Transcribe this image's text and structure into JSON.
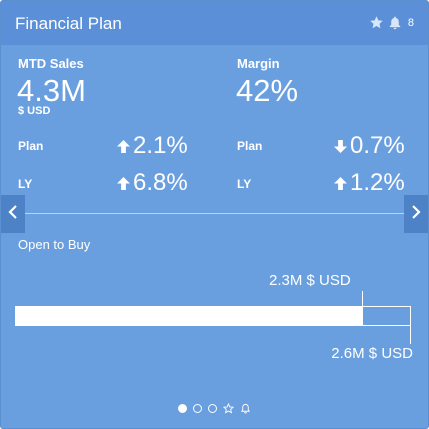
{
  "header": {
    "title": "Financial Plan",
    "favorite_icon": "star-icon",
    "alert_icon": "bell-icon",
    "alert_count": "8"
  },
  "kpis": [
    {
      "label": "MTD Sales",
      "value": "4.3M",
      "unit": "$ USD"
    },
    {
      "label": "Margin",
      "value": "42%",
      "unit": ""
    }
  ],
  "comparisons": {
    "sales": [
      {
        "label": "Plan",
        "direction": "up",
        "value": "2.1%"
      },
      {
        "label": "LY",
        "direction": "up",
        "value": "6.8%"
      }
    ],
    "margin": [
      {
        "label": "Plan",
        "direction": "down",
        "value": "0.7%"
      },
      {
        "label": "LY",
        "direction": "up",
        "value": "1.2%"
      }
    ]
  },
  "navigation": {
    "prev_icon": "chevron-left-icon",
    "next_icon": "chevron-right-icon"
  },
  "open_to_buy": {
    "label": "Open to Buy",
    "actual_label": "2.3M $ USD",
    "actual_value": 2.3,
    "target_label": "2.6M $ USD",
    "target_value": 2.6
  },
  "pager": {
    "pages": 3,
    "active_index": 0,
    "extra_icons": [
      "star-icon",
      "bell-icon"
    ]
  },
  "colors": {
    "card_bg": "#6a9fdf",
    "header_bg": "#5b90d8",
    "nav_bg": "#4d82c6",
    "text": "#ffffff"
  }
}
